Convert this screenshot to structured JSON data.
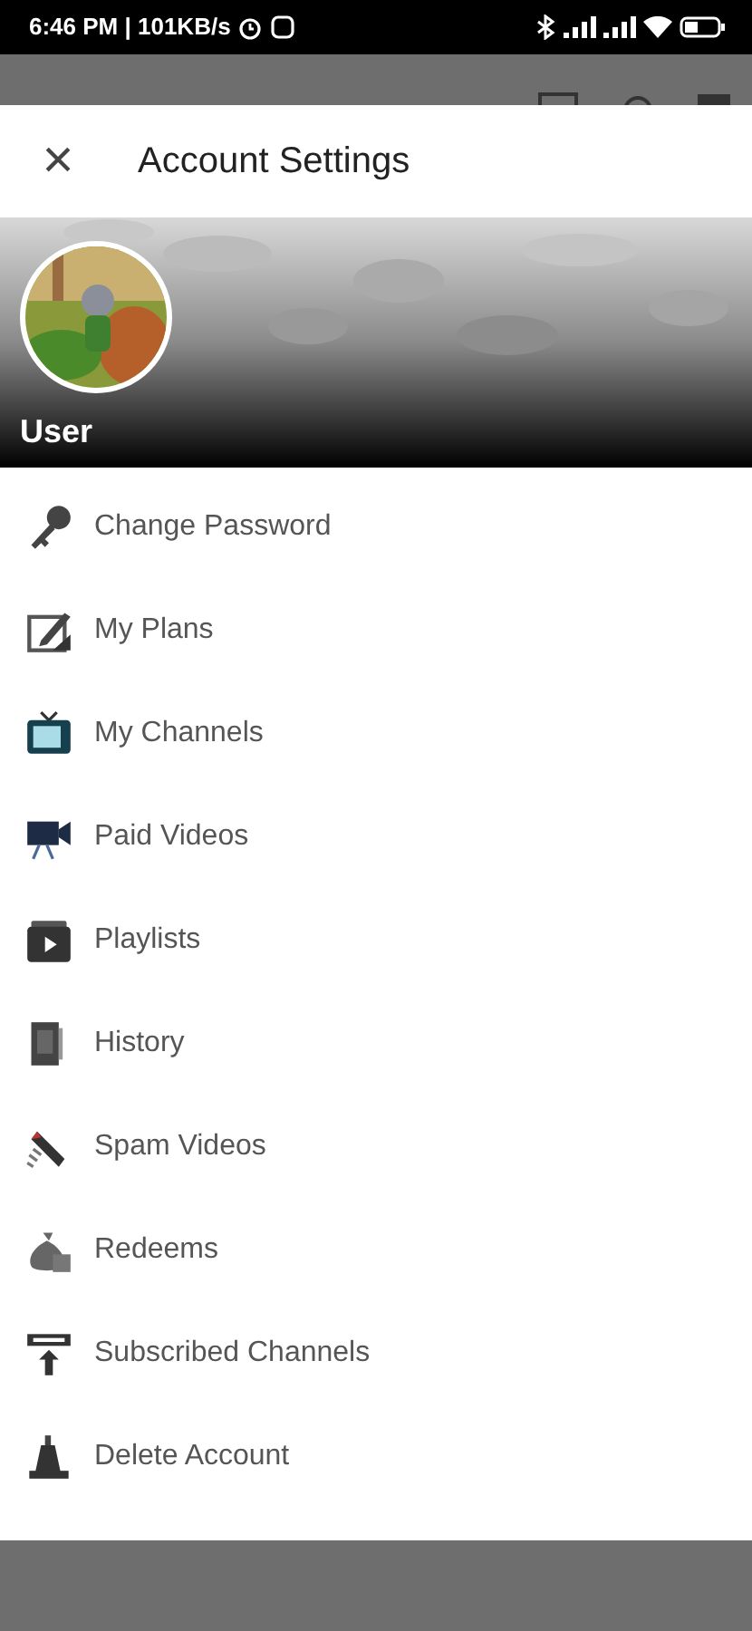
{
  "status_bar": {
    "time": "6:46 PM | 101KB/s"
  },
  "dialog": {
    "title": "Account Settings",
    "close": "×"
  },
  "profile": {
    "name": "User"
  },
  "menu": [
    {
      "label": "Change Password"
    },
    {
      "label": "My Plans"
    },
    {
      "label": "My Channels"
    },
    {
      "label": "Paid Videos"
    },
    {
      "label": "Playlists"
    },
    {
      "label": "History"
    },
    {
      "label": "Spam Videos"
    },
    {
      "label": "Redeems"
    },
    {
      "label": "Subscribed Channels"
    },
    {
      "label": "Delete Account"
    }
  ]
}
